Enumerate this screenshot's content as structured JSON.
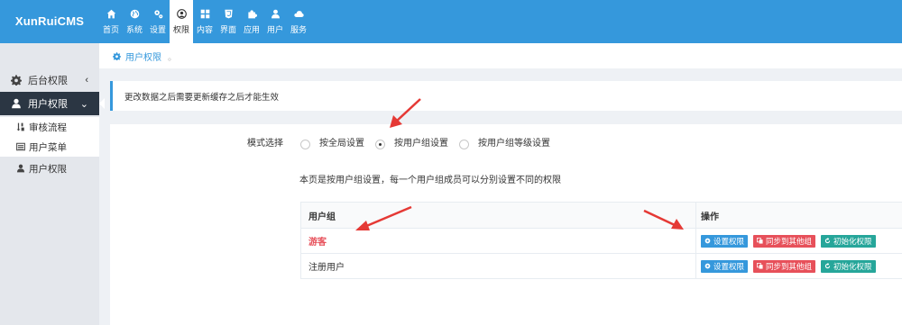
{
  "app": {
    "logo": "XunRuiCMS"
  },
  "nav": [
    {
      "label": "首页",
      "icon": "home-icon"
    },
    {
      "label": "系统",
      "icon": "globe-icon"
    },
    {
      "label": "设置",
      "icon": "cogs-icon"
    },
    {
      "label": "权限",
      "icon": "user-circle-icon",
      "active": true
    },
    {
      "label": "内容",
      "icon": "grid-icon"
    },
    {
      "label": "界面",
      "icon": "html5-icon"
    },
    {
      "label": "应用",
      "icon": "puzzle-icon"
    },
    {
      "label": "用户",
      "icon": "user-icon"
    },
    {
      "label": "服务",
      "icon": "cloud-icon"
    }
  ],
  "sidebar": {
    "group1": {
      "label": "后台权限",
      "chevron": "‹"
    },
    "group2": {
      "label": "用户权限",
      "chevron": "⌄"
    },
    "items": [
      {
        "label": "审核流程",
        "icon": "sort-icon"
      },
      {
        "label": "用户菜单",
        "icon": "list-icon"
      },
      {
        "label": "用户权限",
        "icon": "user-icon"
      }
    ]
  },
  "breadcrumb": {
    "label": "用户权限",
    "sep": "。"
  },
  "note": {
    "text": "更改数据之后需要更新缓存之后才能生效"
  },
  "form": {
    "mode_label": "模式选择",
    "options": [
      {
        "label": "按全局设置",
        "checked": false
      },
      {
        "label": "按用户组设置",
        "checked": true
      },
      {
        "label": "按用户组等级设置",
        "checked": false
      }
    ],
    "description": "本页是按用户组设置，每一个用户组成员可以分别设置不同的权限"
  },
  "table": {
    "headers": [
      "用户组",
      "操作"
    ],
    "rows": [
      {
        "name": "游客",
        "highlight": true
      },
      {
        "name": "注册用户",
        "highlight": false
      }
    ],
    "buttons": {
      "set": "设置权限",
      "sync": "同步到其他组",
      "reset": "初始化权限"
    }
  },
  "colors": {
    "primary": "#3598dc",
    "danger": "#e7505a",
    "success": "#26a69a",
    "sidebar_active": "#2b3643"
  }
}
